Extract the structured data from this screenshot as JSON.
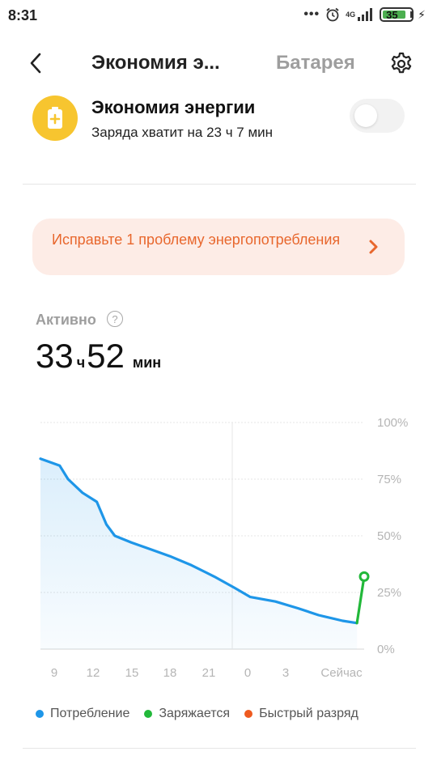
{
  "status_bar": {
    "time": "8:31",
    "dots": "•••",
    "network": "4G",
    "battery_level": "35"
  },
  "header": {
    "title": "Экономия э...",
    "tab": "Батарея"
  },
  "power_saving": {
    "title": "Экономия энергии",
    "subtitle": "Заряда хватит на 23 ч 7 мин",
    "enabled": false
  },
  "issue": {
    "text": "Исправьте 1 проблему энергопотребления"
  },
  "active": {
    "label": "Активно",
    "help": "?",
    "hours": "33",
    "hours_unit": "ч",
    "minutes": "52",
    "minutes_unit": "мин"
  },
  "colors": {
    "consumption": "#1e96e8",
    "charging": "#22b83a",
    "fast_drain": "#ee5a1f",
    "accent": "#e8672d"
  },
  "chart_data": {
    "type": "line",
    "x_labels": [
      "9",
      "12",
      "15",
      "18",
      "21",
      "0",
      "3",
      "Сейчас"
    ],
    "y_labels": [
      "100%",
      "75%",
      "50%",
      "25%",
      "0%"
    ],
    "ylim": [
      0,
      100
    ],
    "series": [
      {
        "name": "Потребление",
        "points": [
          [
            8,
            84
          ],
          [
            9.6,
            81
          ],
          [
            10.3,
            75
          ],
          [
            11.5,
            69
          ],
          [
            12.7,
            65
          ],
          [
            13.5,
            55
          ],
          [
            14.2,
            50
          ],
          [
            15.6,
            47
          ],
          [
            17.2,
            44
          ],
          [
            18.8,
            41
          ],
          [
            20.6,
            37
          ],
          [
            22.5,
            32
          ],
          [
            24.2,
            27
          ],
          [
            25.5,
            23
          ],
          [
            27.6,
            21
          ],
          [
            29.5,
            18
          ],
          [
            31.2,
            15
          ],
          [
            33.2,
            12.5
          ],
          [
            34.4,
            11.5
          ]
        ]
      },
      {
        "name": "Заряжается",
        "points": [
          [
            34.4,
            11.5
          ],
          [
            35,
            32
          ]
        ]
      }
    ],
    "vertical_line_at": 24,
    "legend": [
      {
        "label": "Потребление",
        "color": "#1e96e8"
      },
      {
        "label": "Заряжается",
        "color": "#22b83a"
      },
      {
        "label": "Быстрый разряд",
        "color": "#ee5a1f"
      }
    ]
  }
}
